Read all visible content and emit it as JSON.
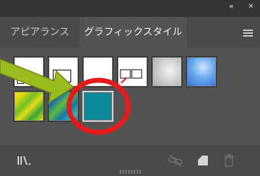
{
  "panel": {
    "collapse_label": "«",
    "close_label": "✕",
    "tabs": [
      {
        "label": "アピアランス",
        "active": false
      },
      {
        "label": "グラフィックスタイル",
        "active": true
      }
    ],
    "menu_icon": "panel-menu-icon"
  },
  "swatches": [
    {
      "name": "default-graphic-style",
      "kind": "white-square-black-corner"
    },
    {
      "name": "default-text-style",
      "kind": "white-square-frame"
    },
    {
      "name": "white-plain-style",
      "kind": "white"
    },
    {
      "name": "no-fill-red-slash-style",
      "kind": "red-slash-frames"
    },
    {
      "name": "gray-bevel-style",
      "kind": "gray-gradient"
    },
    {
      "name": "blue-gradient-style",
      "kind": "blue-gradient"
    },
    {
      "name": "yellow-green-pattern-style",
      "kind": "yellow-green"
    },
    {
      "name": "blue-green-pattern-style",
      "kind": "blue-green"
    },
    {
      "name": "teal-fill-style",
      "kind": "teal",
      "color": "#0d8a99"
    }
  ],
  "annotations": {
    "arrow_color": "#9bbb1e",
    "highlight_circle_color": "#e81919"
  },
  "bottom": {
    "icons": [
      "graphic-style-libraries-menu-icon",
      "break-link-icon",
      "new-graphic-style-icon",
      "delete-graphic-style-icon"
    ]
  }
}
